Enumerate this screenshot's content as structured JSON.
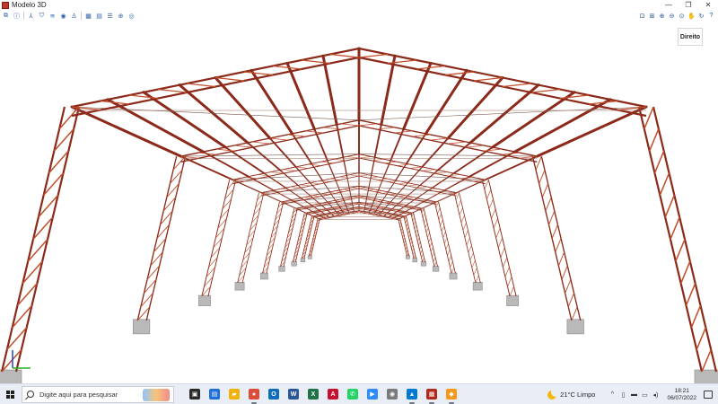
{
  "window": {
    "title": "Modelo 3D",
    "minimize": "—",
    "restore": "❐",
    "close": "✕"
  },
  "toolbar": {
    "left_icons": [
      "copy-icon",
      "info-icon",
      "axes-icon",
      "shield-icon",
      "layers-icon",
      "eye-icon",
      "person-icon",
      "grid-icon",
      "table-icon",
      "list-icon",
      "globe-icon",
      "view-eye-icon"
    ],
    "right_icons": [
      "zoom-window-icon",
      "zoom-all-icon",
      "zoom-in-icon",
      "zoom-out-icon",
      "zoom-prev-icon",
      "pan-icon",
      "rotate-icon",
      "help-icon"
    ]
  },
  "view": {
    "direction_button": "Direito",
    "frame_color": "#8b2a1a",
    "joint_color": "#c0502c",
    "footing_color": "#b9b9b9"
  },
  "taskbar": {
    "search_placeholder": "Digite aqui para pesquisar",
    "apps": [
      {
        "name": "taskview",
        "color": "#2a2a2a",
        "glyph": "▣",
        "running": false
      },
      {
        "name": "store",
        "color": "#1e6fd9",
        "glyph": "▤",
        "running": false
      },
      {
        "name": "explorer",
        "color": "#f1b20e",
        "glyph": "▰",
        "running": false
      },
      {
        "name": "chrome",
        "color": "#dd4b39",
        "glyph": "●",
        "running": true
      },
      {
        "name": "outlook",
        "color": "#0f6cbd",
        "glyph": "O",
        "running": false
      },
      {
        "name": "word",
        "color": "#2b579a",
        "glyph": "W",
        "running": false
      },
      {
        "name": "excel",
        "color": "#217346",
        "glyph": "X",
        "running": false
      },
      {
        "name": "autocad",
        "color": "#c8102e",
        "glyph": "A",
        "running": false
      },
      {
        "name": "whatsapp",
        "color": "#25d366",
        "glyph": "✆",
        "running": false
      },
      {
        "name": "zoom",
        "color": "#2d8cff",
        "glyph": "▶",
        "running": false
      },
      {
        "name": "webcam",
        "color": "#7a7a7a",
        "glyph": "◉",
        "running": false
      },
      {
        "name": "photos",
        "color": "#0078d4",
        "glyph": "▲",
        "running": true
      },
      {
        "name": "structural-app",
        "color": "#b22a1a",
        "glyph": "▦",
        "running": true
      },
      {
        "name": "orange-app",
        "color": "#f39a1e",
        "glyph": "◆",
        "running": true
      }
    ],
    "weather": "21°C  Limpo",
    "time": "18:21",
    "date": "06/07/2022"
  }
}
